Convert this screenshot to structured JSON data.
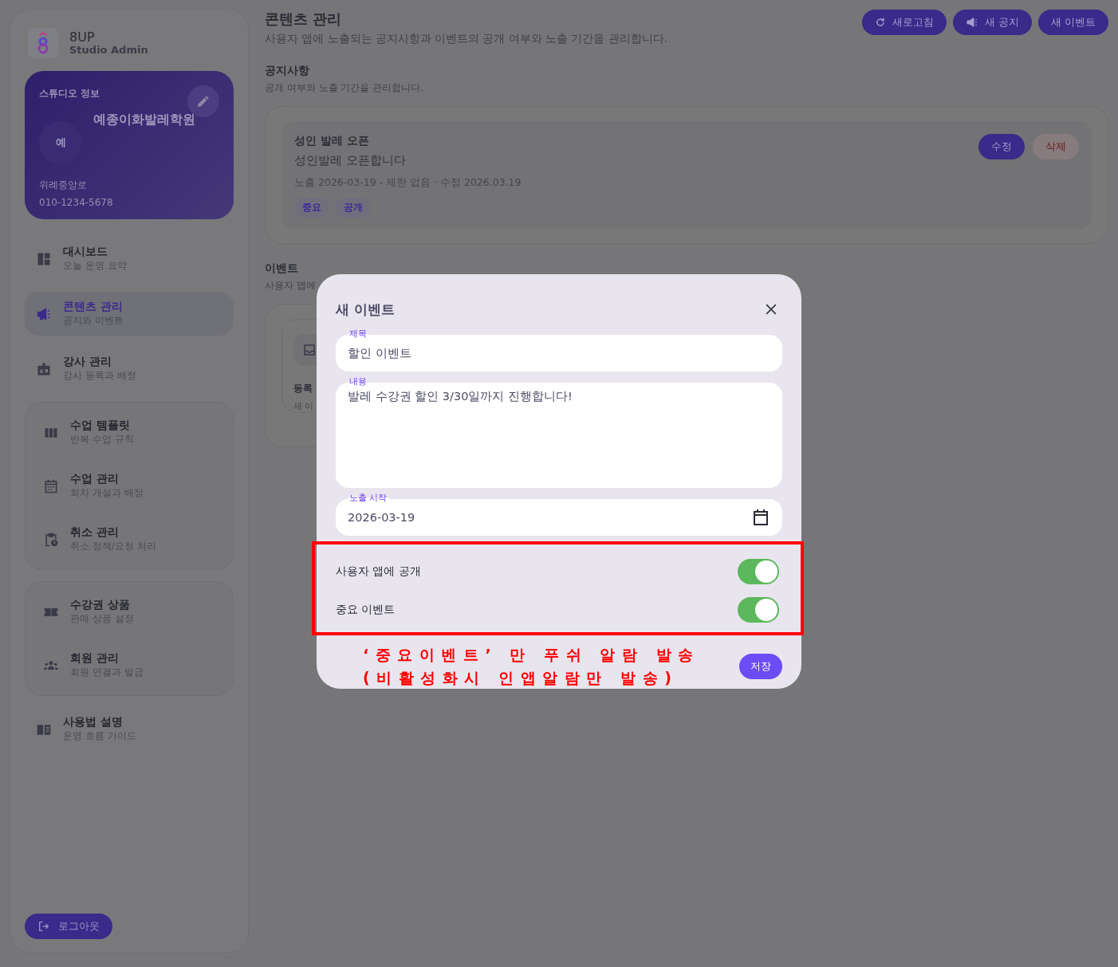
{
  "sidebar": {
    "brand": {
      "name": "8UP",
      "subtitle": "Studio Admin"
    },
    "studio_card": {
      "heading": "스튜디오 정보",
      "avatar_text": "예",
      "name": "예종이화발레학원",
      "address": "위례중앙로",
      "phone": "010-1234-5678"
    },
    "nav": [
      {
        "kind": "item",
        "title": "대시보드",
        "subtitle": "오늘 운영 요약",
        "selected": false
      },
      {
        "kind": "item",
        "title": "콘텐츠 관리",
        "subtitle": "공지와 이벤트",
        "selected": true
      },
      {
        "kind": "item",
        "title": "강사 관리",
        "subtitle": "강사 등록과 배정",
        "selected": false
      },
      {
        "kind": "group",
        "items": [
          {
            "title": "수업 템플릿",
            "subtitle": "반복 수업 규칙",
            "selected": false
          },
          {
            "title": "수업 관리",
            "subtitle": "회차 개설과 배정",
            "selected": false
          },
          {
            "title": "취소 관리",
            "subtitle": "취소 정책/요청 처리",
            "selected": false
          }
        ]
      },
      {
        "kind": "group",
        "items": [
          {
            "title": "수강권 상품",
            "subtitle": "판매 상품 설정",
            "selected": false
          },
          {
            "title": "회원 관리",
            "subtitle": "회원 연결과 발급",
            "selected": false
          }
        ]
      },
      {
        "kind": "item",
        "title": "사용법 설명",
        "subtitle": "운영 흐름 가이드",
        "selected": false
      }
    ],
    "logout": "로그아웃"
  },
  "main": {
    "title": "콘텐츠 관리",
    "subtitle": "사용자 앱에 노출되는 공지사항과 이벤트의 공개 여부와 노출 기간을 관리합니다.",
    "actions": [
      "새로고침",
      "새 공지",
      "새 이벤트"
    ],
    "notices": {
      "title": "공지사항",
      "subtitle": "공개 여부와 노출 기간을 관리합니다.",
      "items": [
        {
          "title": "성인 발레 오픈",
          "body": "성인발레 오픈합니다",
          "meta": "노출 2026-03-19 - 제한 없음 · 수정 2026.03.19",
          "tags": [
            "중요",
            "공개"
          ],
          "actions": [
            {
              "label": "수정",
              "kind": "primary"
            },
            {
              "label": "삭제",
              "kind": "danger"
            }
          ]
        }
      ]
    },
    "events": {
      "title": "이벤트",
      "subtitle": "사용자 앱에",
      "card": {
        "title": "등록",
        "text": "새 이"
      }
    }
  },
  "modal": {
    "title": "새 이벤트",
    "fields": [
      {
        "kind": "text",
        "label": "제목",
        "value": "할인 이벤트"
      },
      {
        "kind": "textarea",
        "label": "내용",
        "value": "발레 수강권 할인 3/30일까지 진행합니다!"
      },
      {
        "kind": "date",
        "label": "노출 시작",
        "value": "2026-03-19"
      }
    ],
    "toggles": [
      {
        "label": "사용자 앱에 공개",
        "on": true
      },
      {
        "label": "중요 이벤트",
        "on": true
      }
    ],
    "annotation": [
      "‘중요이벤트’ 만 푸쉬 알람 발송",
      "(비활성화시 인앱알람만 발송)"
    ],
    "save": "저장"
  }
}
